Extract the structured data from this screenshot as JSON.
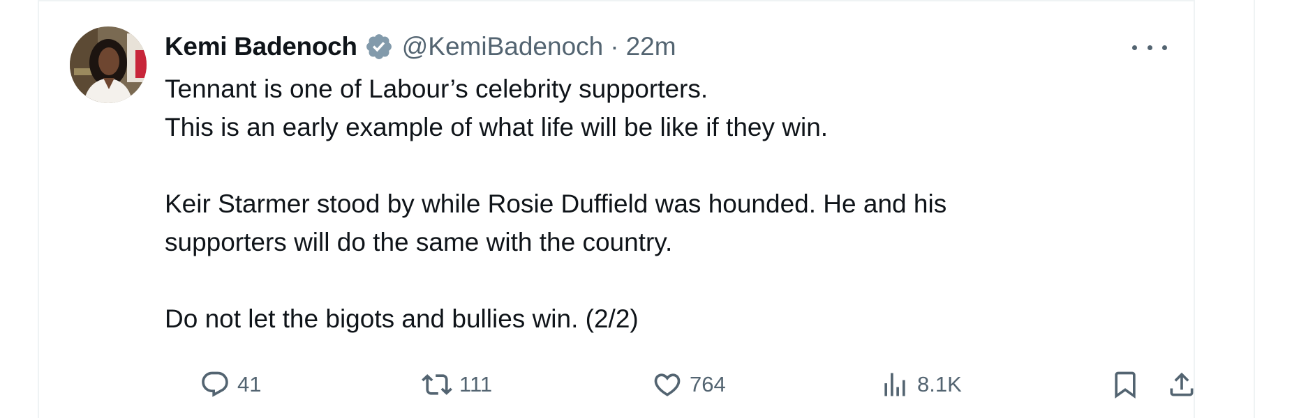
{
  "tweet": {
    "display_name": "Kemi Badenoch",
    "handle": "@KemiBadenoch",
    "separator": "·",
    "time": "22m",
    "paragraphs": [
      "Tennant is one of Labour’s celebrity supporters.",
      "This is an early example of what life will be like if they win.",
      "Keir Starmer stood by while Rosie Duffield was hounded. He and his",
      "supporters will do the same with the country.",
      "Do not let the bigots and bullies win. (2/2)"
    ],
    "verified_color": "#829aab"
  },
  "actions": {
    "replies": "41",
    "reposts": "111",
    "likes": "764",
    "views": "8.1K"
  },
  "icons": {
    "reply": "reply-icon",
    "repost": "repost-icon",
    "like": "heart-icon",
    "views": "views-icon",
    "bookmark": "bookmark-icon",
    "share": "share-icon",
    "more": "more-icon",
    "verified": "verified-badge-icon"
  },
  "colors": {
    "text": "#0f1419",
    "secondary": "#536471",
    "border": "#eff3f4"
  }
}
